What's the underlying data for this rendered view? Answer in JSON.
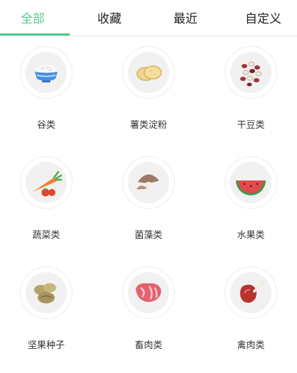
{
  "tabs": [
    {
      "label": "全部",
      "active": true
    },
    {
      "label": "收藏",
      "active": false
    },
    {
      "label": "最近",
      "active": false
    },
    {
      "label": "自定义",
      "active": false
    }
  ],
  "colors": {
    "accent": "#58c98e",
    "text": "#333333"
  },
  "categories": [
    {
      "label": "谷类",
      "icon": "rice-bowl-icon"
    },
    {
      "label": "薯类淀粉",
      "icon": "potato-slices-icon"
    },
    {
      "label": "干豆类",
      "icon": "dried-beans-icon"
    },
    {
      "label": "蔬菜类",
      "icon": "carrot-tomato-icon"
    },
    {
      "label": "菌藻类",
      "icon": "mushroom-icon"
    },
    {
      "label": "水果类",
      "icon": "watermelon-icon"
    },
    {
      "label": "坚果种子",
      "icon": "nuts-icon"
    },
    {
      "label": "畜肉类",
      "icon": "raw-meat-icon"
    },
    {
      "label": "禽肉类",
      "icon": "poultry-leg-icon"
    }
  ]
}
